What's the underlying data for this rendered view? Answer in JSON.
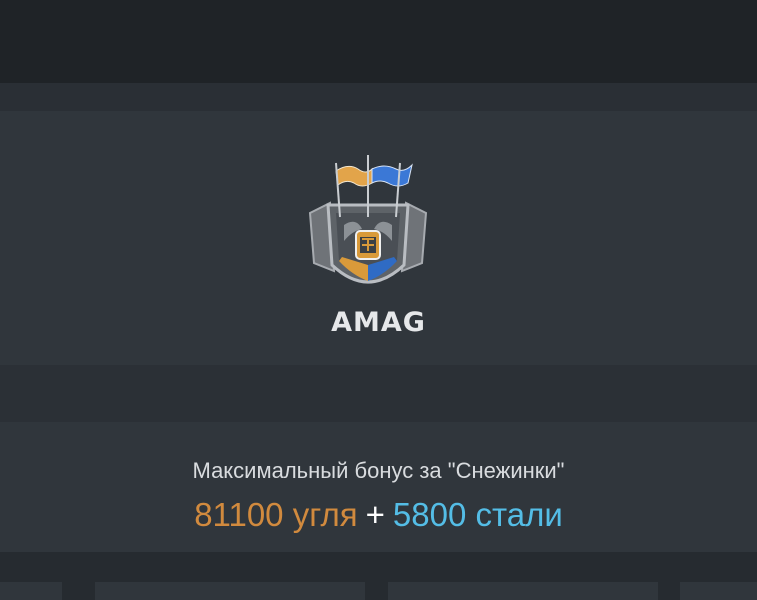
{
  "clan": {
    "tag": "AMAG",
    "emblem_icon": "clan-emblem-icon"
  },
  "bonus": {
    "title": "Максимальный бонус за \"Снежинки\"",
    "coal_amount": "81100 угля",
    "plus": "+",
    "steel_amount": "5800 стали"
  },
  "colors": {
    "coal": "#d18a3e",
    "steel": "#54bde6",
    "panel": "#30363c"
  }
}
